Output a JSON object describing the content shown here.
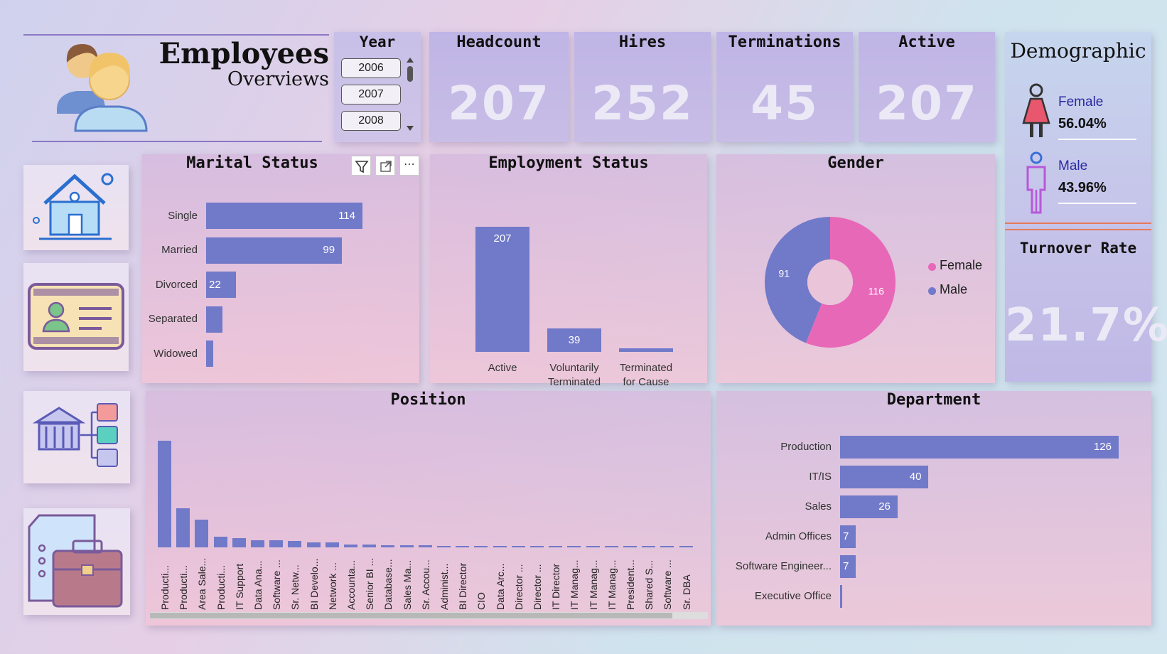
{
  "header": {
    "title": "Employees",
    "subtitle": "Overviews"
  },
  "year_slicer": {
    "title": "Year",
    "options": [
      "2006",
      "2007",
      "2008"
    ]
  },
  "kpis": [
    {
      "label": "Headcount",
      "value": "207"
    },
    {
      "label": "Hires",
      "value": "252"
    },
    {
      "label": "Terminations",
      "value": "45"
    },
    {
      "label": "Active",
      "value": "207"
    }
  ],
  "demographic": {
    "title": "Demographic",
    "female_label": "Female",
    "female_value": "56.04%",
    "male_label": "Male",
    "male_value": "43.96%"
  },
  "turnover": {
    "title": "Turnover Rate",
    "value": "21.7%"
  },
  "colors": {
    "bar": "#7179c9",
    "female": "#e868b8",
    "male": "#7179c9"
  },
  "chart_data": [
    {
      "id": "marital",
      "type": "bar",
      "orientation": "horizontal",
      "title": "Marital Status",
      "categories": [
        "Single",
        "Married",
        "Divorced",
        "Separated",
        "Widowed"
      ],
      "values": [
        114,
        99,
        22,
        12,
        5
      ],
      "labels": [
        "114",
        "99",
        "22",
        "",
        ""
      ]
    },
    {
      "id": "employment",
      "type": "bar",
      "title": "Employment Status",
      "categories": [
        "Active",
        "Voluntarily Terminated",
        "Terminated for Cause"
      ],
      "category_lines": [
        [
          "Active"
        ],
        [
          "Voluntarily",
          "Terminated"
        ],
        [
          "Terminated",
          "for Cause"
        ]
      ],
      "values": [
        207,
        39,
        6
      ],
      "labels": [
        "207",
        "39",
        ""
      ]
    },
    {
      "id": "gender",
      "type": "pie",
      "title": "Gender",
      "donut": true,
      "slices": [
        {
          "name": "Female",
          "value": 116
        },
        {
          "name": "Male",
          "value": 91
        }
      ],
      "legend": [
        "Female",
        "Male"
      ],
      "legend_position": "right"
    },
    {
      "id": "position",
      "type": "bar",
      "title": "Position",
      "categories": [
        "Producti...",
        "Producti...",
        "Area Sale...",
        "Producti...",
        "IT Support",
        "Data Ana...",
        "Software ...",
        "Sr. Netw...",
        "BI Develo...",
        "Network ...",
        "Accounta...",
        "Senior BI ...",
        "Database...",
        "Sales Ma...",
        "Sr. Accou...",
        "Administ...",
        "BI Director",
        "CIO",
        "Data Arc...",
        "Director ...",
        "Director ...",
        "IT Director",
        "IT Manag...",
        "IT Manag...",
        "IT Manag...",
        "President...",
        "Shared S...",
        "Software ...",
        "Sr. DBA"
      ],
      "values": [
        137,
        50,
        36,
        14,
        12,
        9,
        9,
        8,
        6,
        6,
        4,
        4,
        3,
        3,
        3,
        2,
        1,
        1,
        1,
        1,
        1,
        1,
        1,
        1,
        1,
        1,
        1,
        1,
        1
      ]
    },
    {
      "id": "department",
      "type": "bar",
      "orientation": "horizontal",
      "title": "Department",
      "categories": [
        "Production",
        "IT/IS",
        "Sales",
        "Admin Offices",
        "Software Engineer...",
        "Executive Office"
      ],
      "values": [
        126,
        40,
        26,
        7,
        7,
        1
      ],
      "labels": [
        "126",
        "40",
        "26",
        "7",
        "7",
        ""
      ]
    }
  ]
}
